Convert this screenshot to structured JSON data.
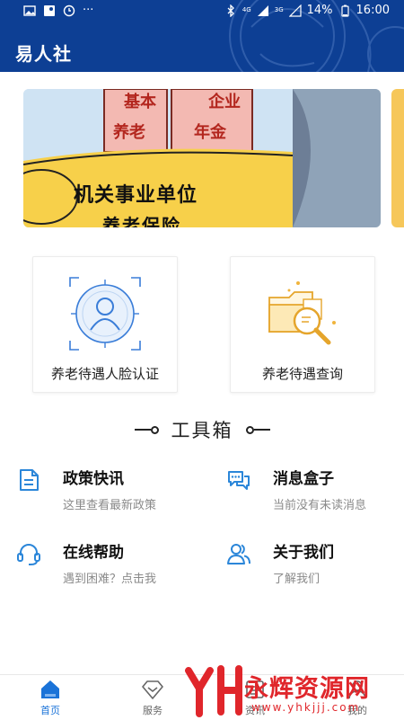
{
  "status_bar": {
    "network_4g": "4G",
    "network_2g": "3G",
    "battery": "14%",
    "time": "16:00",
    "more": "···"
  },
  "header": {
    "title": "易人社",
    "color": "#0d3f94"
  },
  "banner": {
    "tag_basic": "基本",
    "tag_pension": "养老",
    "tag_enterprise": "企业",
    "tag_annuity": "年金",
    "line1": "机关事业单位",
    "line2": "养老保险"
  },
  "cards": [
    {
      "label": "养老待遇人脸认证",
      "icon": "face-scan-icon"
    },
    {
      "label": "养老待遇查询",
      "icon": "folder-search-icon"
    }
  ],
  "toolbox": {
    "title": "工具箱",
    "items": [
      {
        "title": "政策快讯",
        "desc": "这里查看最新政策",
        "icon": "document-icon"
      },
      {
        "title": "消息盒子",
        "desc": "当前没有未读消息",
        "icon": "chat-bubbles-icon"
      },
      {
        "title": "在线帮助",
        "desc": "遇到困难？点击我",
        "icon": "headset-icon"
      },
      {
        "title": "关于我们",
        "desc": "了解我们",
        "icon": "users-icon"
      }
    ]
  },
  "bottom_nav": {
    "items": [
      {
        "label": "首页",
        "icon": "home-icon",
        "active": true
      },
      {
        "label": "服务",
        "icon": "diamond-icon",
        "active": false
      },
      {
        "label": "资讯",
        "icon": "news-icon",
        "active": false
      },
      {
        "label": "我的",
        "icon": "person-icon",
        "active": false
      }
    ]
  },
  "watermark": {
    "text": "永辉资源网",
    "url": "www.yhkjjj.com"
  },
  "colors": {
    "accent": "#1a73d8",
    "brand": "#0d3f94",
    "watermark": "#e0262b"
  }
}
